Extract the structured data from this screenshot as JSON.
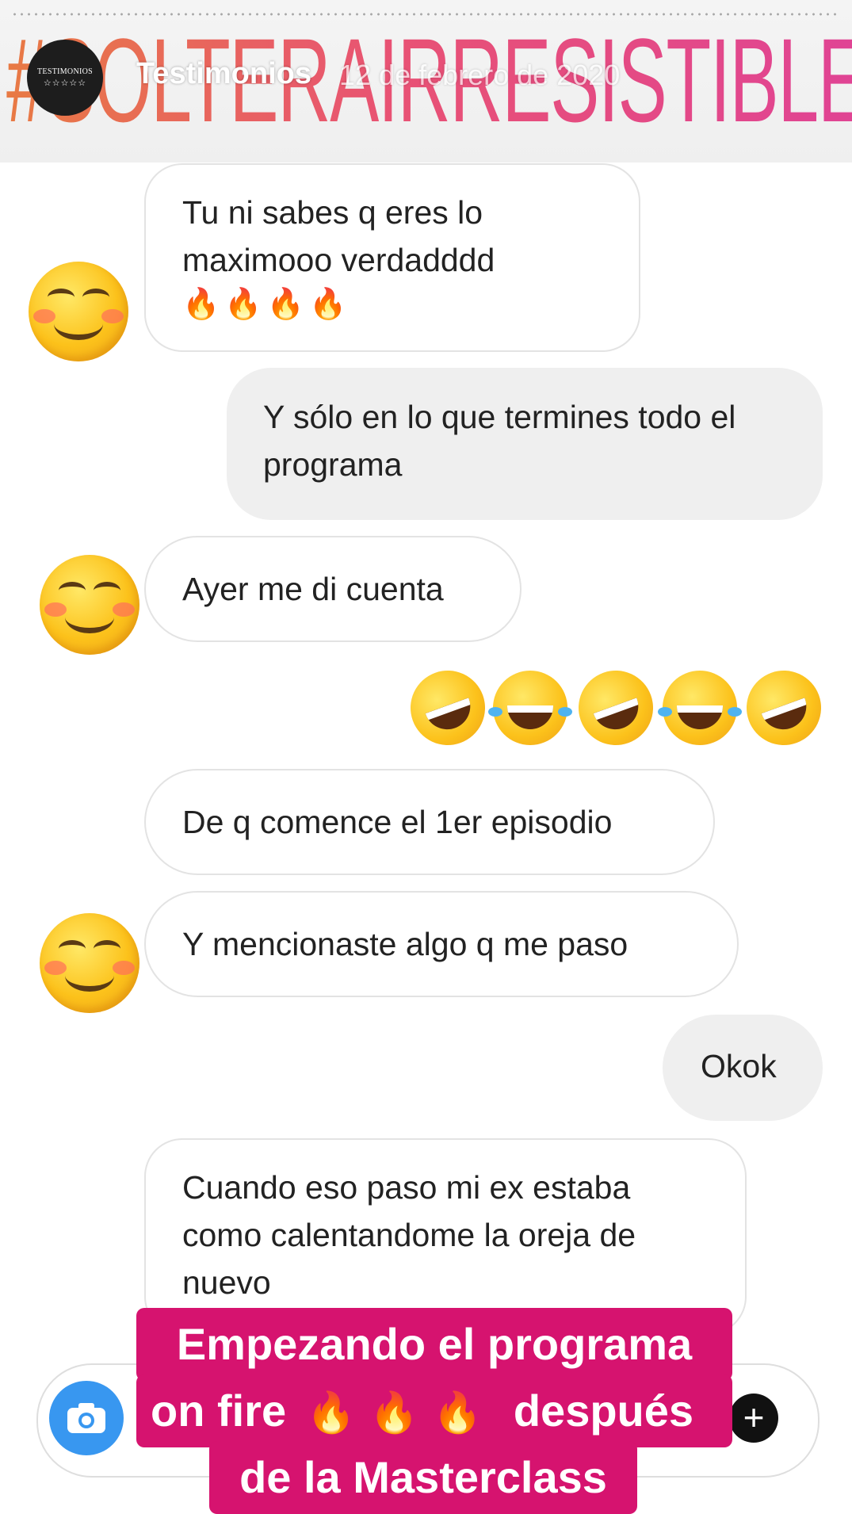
{
  "story": {
    "hashtag": "#SOLTERAIRRESISTIBLE",
    "username": "Testimonios",
    "date": "12 de febrero de 2020",
    "avatar_line1": "TESTIMONIOS",
    "avatar_line2": "☆☆☆☆☆"
  },
  "messages": [
    {
      "from": "them",
      "text": "Tu ni sabes q eres lo maximooo verdadddd",
      "emoji": "🔥🔥🔥🔥"
    },
    {
      "from": "me",
      "text": "Y sólo en lo que termines todo el programa"
    },
    {
      "from": "them",
      "text": "Ayer me di cuenta"
    },
    {
      "from": "me",
      "emoji": "🤣😂🤣😂🤣"
    },
    {
      "from": "them",
      "text": "De q comence el 1er episodio"
    },
    {
      "from": "them",
      "text": "Y mencionaste algo q me paso"
    },
    {
      "from": "me",
      "text": "Okok"
    },
    {
      "from": "them",
      "text": "Cuando eso paso mi ex estaba como calentandome la oreja de nuevo"
    }
  ],
  "reactions": [
    "smiling-face-icon",
    "smiling-face-icon",
    "smiling-face-icon"
  ],
  "overlay": {
    "line1": "Empezando el programa",
    "line2_text": "on fire",
    "line2_emoji": "🔥 🔥 🔥",
    "line2_after": "después",
    "line3": "de la Masterclass",
    "background": "#d6136f"
  },
  "composer": {
    "camera_icon": "camera-icon",
    "add_icon": "plus-icon",
    "add_label": "+"
  }
}
